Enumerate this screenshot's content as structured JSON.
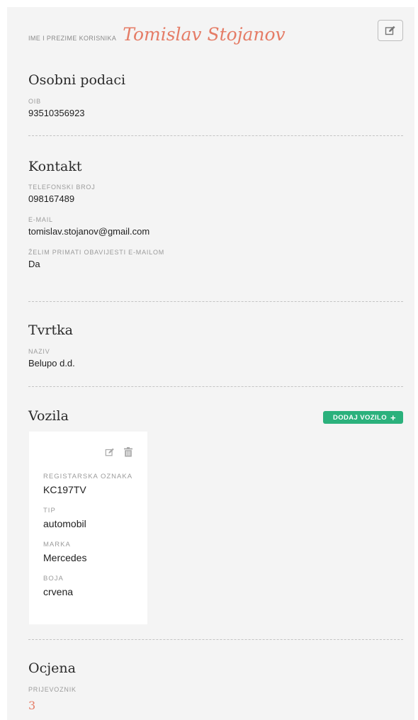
{
  "header": {
    "label": "IME I PREZIME KORISNIKA",
    "name": "Tomislav Stojanov"
  },
  "osobni": {
    "title": "Osobni podaci",
    "oib_label": "OIB",
    "oib_value": "93510356923"
  },
  "kontakt": {
    "title": "Kontakt",
    "phone_label": "TELEFONSKI BROJ",
    "phone_value": "098167489",
    "email_label": "E-MAIL",
    "email_value": "tomislav.stojanov@gmail.com",
    "notify_label": "ŽELIM PRIMATI OBAVIJESTI E-MAILOM",
    "notify_value": "Da"
  },
  "tvrtka": {
    "title": "Tvrtka",
    "name_label": "NAZIV",
    "name_value": "Belupo d.d."
  },
  "vozila": {
    "title": "Vozila",
    "add_label": "DODAJ VOZILO",
    "vehicle": {
      "plate_label": "REGISTARSKA OZNAKA",
      "plate_value": "KC197TV",
      "type_label": "TIP",
      "type_value": "automobil",
      "brand_label": "MARKA",
      "brand_value": "Mercedes",
      "color_label": "BOJA",
      "color_value": "crvena"
    }
  },
  "ocjena": {
    "title": "Ocjena",
    "carrier_label": "PRIJEVOZNIK",
    "carrier_value": "3"
  },
  "icons": {
    "edit": "edit-icon",
    "trash": "trash-icon",
    "plus": "plus-icon"
  },
  "colors": {
    "accent_name": "#e57c66",
    "add_button": "#2bb17c",
    "panel_bg": "#f4f4f4"
  }
}
